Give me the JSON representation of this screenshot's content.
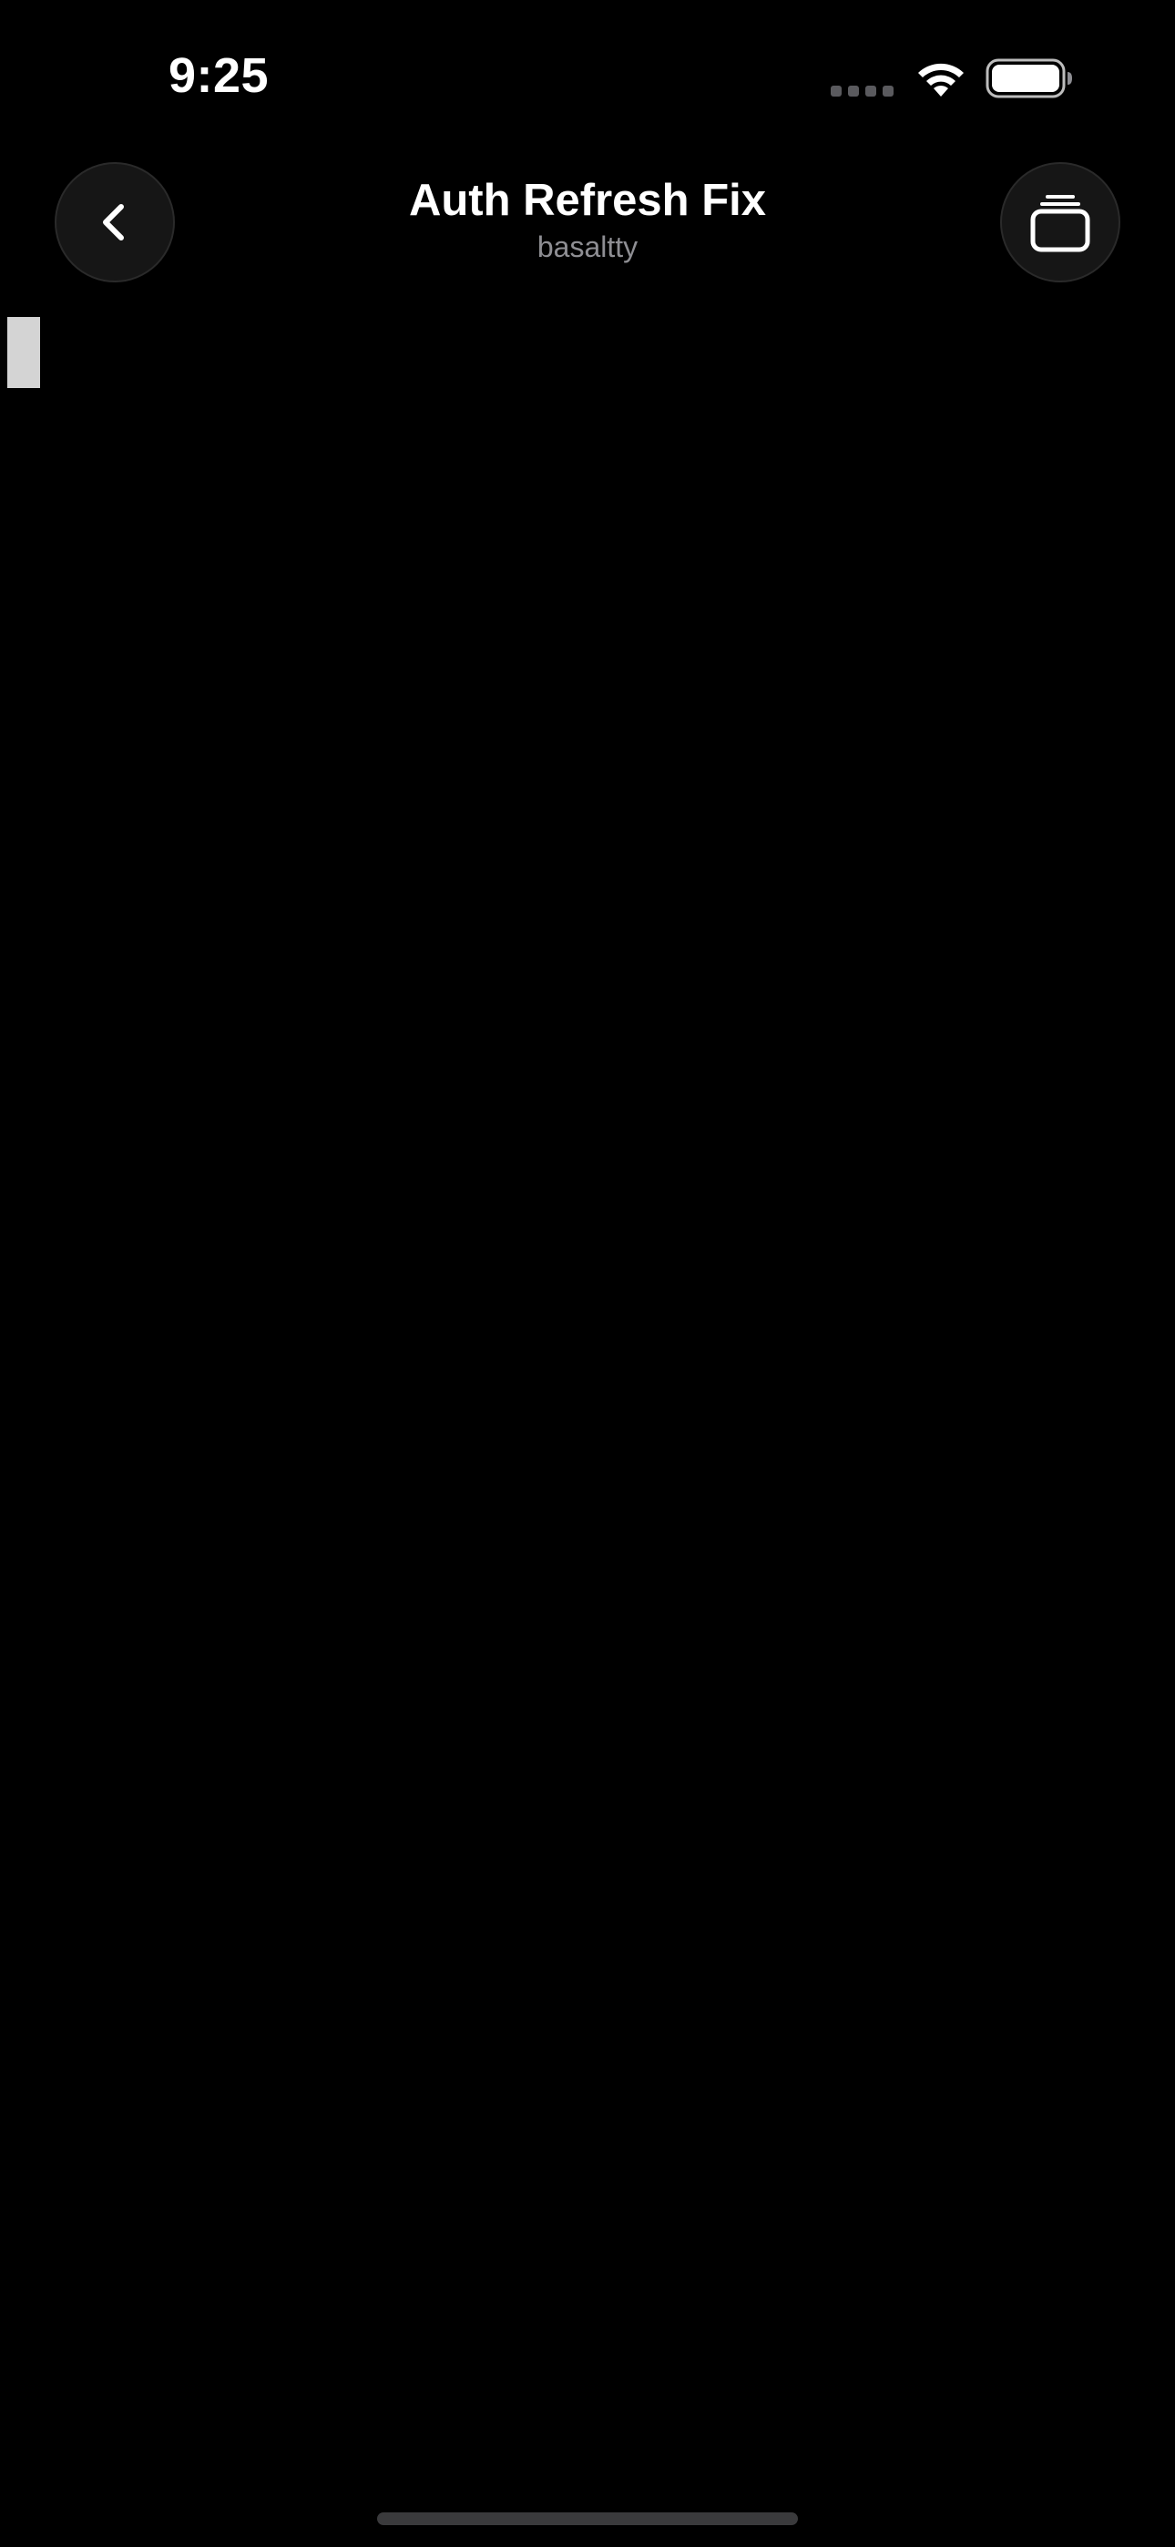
{
  "status_bar": {
    "time": "9:25",
    "icons": [
      "signal-icon",
      "wifi-icon",
      "battery-icon"
    ]
  },
  "header": {
    "title": "Auth Refresh Fix",
    "subtitle": "basaltty",
    "back_icon": "chevron-left-icon",
    "tabs_icon": "stacked-windows-icon"
  },
  "terminal": {
    "content": ""
  },
  "colors": {
    "background": "#000000",
    "button_background": "#161616",
    "subtitle": "#8e8e93",
    "cursor": "#d4d4d4"
  }
}
